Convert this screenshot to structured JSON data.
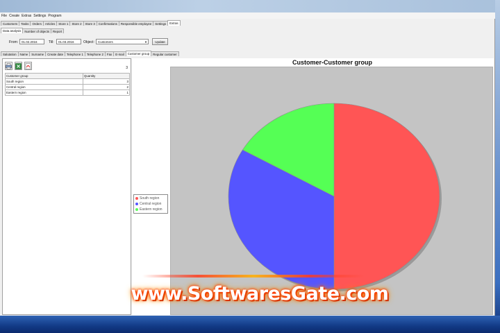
{
  "menu": [
    "File",
    "Create",
    "Extras",
    "Settings",
    "Program"
  ],
  "main_tabs": [
    {
      "label": "Customers",
      "active": false
    },
    {
      "label": "Tasks",
      "active": false
    },
    {
      "label": "Orders",
      "active": false
    },
    {
      "label": "Articles",
      "active": false
    },
    {
      "label": "Store 1",
      "active": false
    },
    {
      "label": "Store 2",
      "active": false
    },
    {
      "label": "Store 3",
      "active": false
    },
    {
      "label": "Confirmations",
      "active": false
    },
    {
      "label": "Responsible employee",
      "active": false
    },
    {
      "label": "Settings",
      "active": false
    },
    {
      "label": "Extras",
      "active": true
    }
  ],
  "sub_tabs": [
    {
      "label": "Data analysis",
      "active": true
    },
    {
      "label": "Number of objects",
      "active": false
    },
    {
      "label": "Report",
      "active": false
    }
  ],
  "filter": {
    "from_label": "From:",
    "from_value": "01.02.2016",
    "till_label": "Till:",
    "till_value": "01.03.2016",
    "object_label": "Object:",
    "object_value": "Customers",
    "update_label": "Update"
  },
  "field_tabs": [
    {
      "label": "Salutation",
      "active": false
    },
    {
      "label": "Name",
      "active": false
    },
    {
      "label": "Surname",
      "active": false
    },
    {
      "label": "Create date",
      "active": false
    },
    {
      "label": "Telephone 1",
      "active": false
    },
    {
      "label": "Telephone 2",
      "active": false
    },
    {
      "label": "Fax",
      "active": false
    },
    {
      "label": "E-mail",
      "active": false
    },
    {
      "label": "Customer group",
      "active": true
    },
    {
      "label": "Regular customer",
      "active": false
    }
  ],
  "left_panel": {
    "counter": "3",
    "columns": [
      "Customer group",
      "Quantity"
    ],
    "rows": [
      [
        "South region",
        "3"
      ],
      [
        "Central region",
        "2"
      ],
      [
        "Eastern region",
        "1"
      ]
    ]
  },
  "chart_data": {
    "type": "pie",
    "title": "Customer-Customer group",
    "categories": [
      "South region",
      "Central region",
      "Eastern region"
    ],
    "values": [
      3,
      2,
      1
    ],
    "colors": [
      "#ff5555",
      "#5555ff",
      "#55ff55"
    ],
    "legend_position": "left"
  },
  "watermark": "www.SoftwaresGate.com",
  "colors": {
    "plot_background": "#c4c4c4",
    "window_background": "#f0f0f0"
  }
}
